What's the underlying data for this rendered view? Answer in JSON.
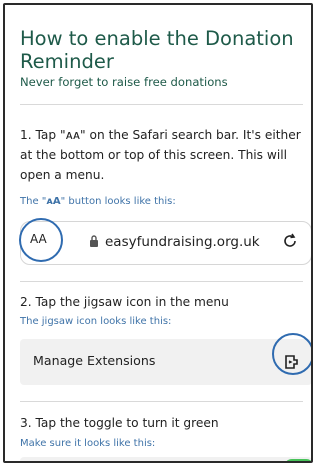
{
  "header": {
    "title": "How to enable the Donation Reminder",
    "subtitle": "Never forget to raise free donations"
  },
  "step1": {
    "text": "1. Tap \"ᴀᴀ\" on the Safari search bar. It's either at the bottom or top of this screen. This will open a menu.",
    "hint_prefix": "The \"",
    "hint_glyph": "ᴀA",
    "hint_suffix": "\" button looks like this:",
    "button_label": "AA",
    "url": "easyfundraising.org.uk"
  },
  "step2": {
    "text": "2. Tap the jigsaw icon in the menu",
    "hint": "The jigsaw icon looks like this:",
    "row_label": "Manage Extensions"
  },
  "step3": {
    "text": "3. Tap the toggle to turn it green",
    "hint": "Make sure it looks like this:"
  },
  "colors": {
    "heading": "#1e5a49",
    "hint": "#3f73a8",
    "ring": "#2f6bb0",
    "toggle_on": "#48c35a"
  },
  "icons": [
    "lock-icon",
    "reload-icon",
    "extension-icon",
    "toggle-switch"
  ]
}
